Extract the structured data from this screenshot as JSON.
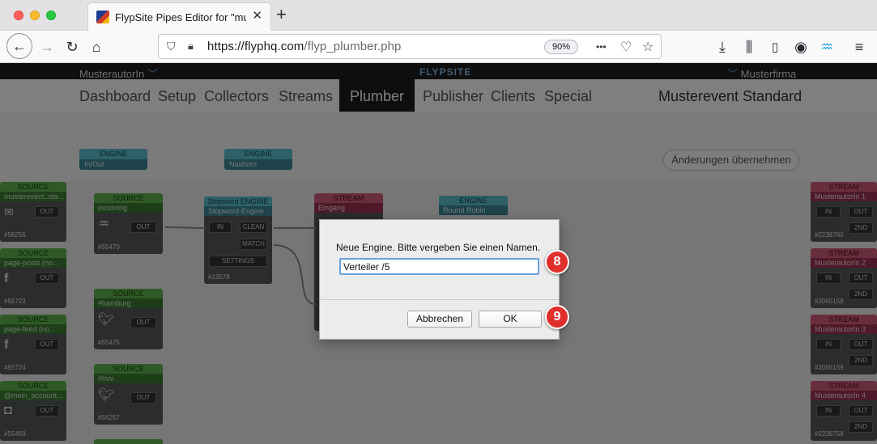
{
  "browser": {
    "tab_title": "FlypSite Pipes Editor for \"muste",
    "tab_close": "✕",
    "new_tab": "+",
    "url_host": "https://flyphq.com",
    "url_path": "/flyp_plumber.php",
    "zoom": "90%",
    "more": "•••"
  },
  "topbar": {
    "author": "MusterautorIn",
    "logo": "FLYPSITE",
    "company": "Musterfirma"
  },
  "nav": {
    "items": [
      "Dashboard",
      "Setup",
      "Collectors",
      "Streams",
      "Plumber",
      "Publisher",
      "Clients",
      "Special"
    ],
    "active": "Plumber",
    "event": "Musterevent Standard"
  },
  "palette": [
    {
      "head": "ENGINE",
      "body": "In/Out"
    },
    {
      "head": "ENGINE",
      "body": "Nashorn"
    }
  ],
  "apply_button": "Änderungen übernehmen",
  "left_sources": [
    {
      "head": "SOURCE",
      "sub": "musterevent..sta...",
      "port": "OUT",
      "id": "#56256"
    },
    {
      "head": "SOURCE",
      "sub": "page-posts (no...",
      "port": "OUT",
      "id": "#55723"
    },
    {
      "head": "SOURCE",
      "sub": "page-feed (no...",
      "port": "OUT",
      "id": "#55724"
    },
    {
      "head": "SOURCE",
      "sub": "@mein_account...",
      "port": "OUT",
      "id": "#55469"
    }
  ],
  "sources": [
    {
      "head": "SOURCE",
      "sub": "incoming",
      "port": "OUT",
      "id": "#55470"
    },
    {
      "head": "SOURCE",
      "sub": "#hamburg",
      "port": "OUT",
      "id": "#55475"
    },
    {
      "head": "SOURCE",
      "sub": "#hvv",
      "port": "OUT",
      "id": "#56257"
    }
  ],
  "stopword": {
    "head": "Stopword ENGINE",
    "sub": "Stopword-Engine",
    "in": "IN",
    "clean": "CLEAN",
    "match": "MATCH",
    "settings": "SETTINGS",
    "id": "#13578"
  },
  "eingang": {
    "head": "STREAM",
    "sub": "Eingang"
  },
  "round_robin": {
    "head": "ENGINE",
    "sub": "Round Robin"
  },
  "streams_right": [
    {
      "head": "STREAM",
      "sub": "MusterautorIn 1",
      "in": "IN",
      "out": "OUT",
      "second": "2ND",
      "id": "#2238760"
    },
    {
      "head": "STREAM",
      "sub": "MusterautorIn 2",
      "in": "IN",
      "out": "OUT",
      "second": "2ND",
      "id": "#2065158"
    },
    {
      "head": "STREAM",
      "sub": "MusterautorIn 3",
      "in": "IN",
      "out": "OUT",
      "second": "2ND",
      "id": "#2065159"
    },
    {
      "head": "STREAM",
      "sub": "MusterautorIn 4",
      "in": "IN",
      "out": "OUT",
      "second": "2ND",
      "id": "#2238759"
    }
  ],
  "dialog": {
    "message": "Neue Engine. Bitte vergeben Sie einen Namen.",
    "value": "Verteiler /5",
    "cancel": "Abbrechen",
    "ok": "OK",
    "badge_input": "8",
    "badge_ok": "9"
  },
  "colors": {
    "source": "#5fb44e",
    "stream": "#d35d7a",
    "engine": "#5bc0cf",
    "badge": "#e0302d"
  }
}
